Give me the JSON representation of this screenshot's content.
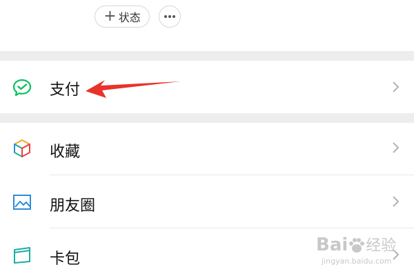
{
  "header": {
    "status_button": {
      "icon": "plus-icon",
      "label": "状态"
    },
    "more_button": {
      "icon": "more-dots-icon"
    }
  },
  "menu": {
    "pay": {
      "label": "支付",
      "icon": "wechat-pay-icon"
    },
    "favorites": {
      "label": "收藏",
      "icon": "favorites-cube-icon"
    },
    "moments": {
      "label": "朋友圈",
      "icon": "moments-image-icon"
    },
    "cards": {
      "label": "卡包",
      "icon": "card-wallet-icon"
    },
    "chevron_icon": "chevron-right-icon"
  },
  "annotation": {
    "arrow_color": "#e8322a",
    "target": "pay"
  },
  "watermark": {
    "brand": "Bai",
    "brand_suffix": "经验",
    "url": "jingyan.baidu.com"
  },
  "colors": {
    "background": "#ffffff",
    "section_gap": "#ededed",
    "accent_green": "#07c160",
    "moments_blue": "#2f8bd8"
  }
}
